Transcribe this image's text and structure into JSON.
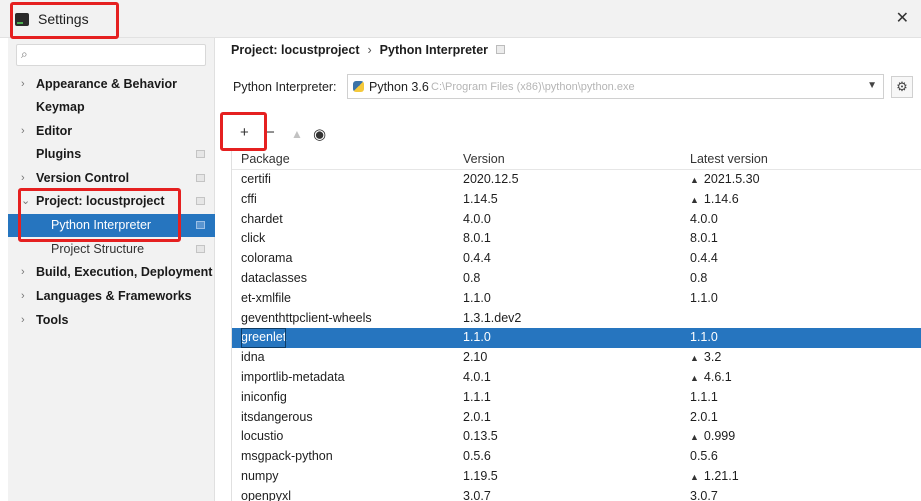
{
  "window": {
    "title": "Settings",
    "close_glyph": "✕"
  },
  "sidebar": {
    "search_placeholder": "",
    "items": [
      {
        "label": "Appearance & Behavior",
        "arrow": "›",
        "has_module_icon": false
      },
      {
        "label": "Keymap",
        "arrow": "",
        "has_module_icon": false
      },
      {
        "label": "Editor",
        "arrow": "›",
        "has_module_icon": false
      },
      {
        "label": "Plugins",
        "arrow": "",
        "has_module_icon": true
      },
      {
        "label": "Version Control",
        "arrow": "›",
        "has_module_icon": true
      },
      {
        "label": "Project: locustproject",
        "arrow": "⌄",
        "has_module_icon": true
      },
      {
        "label": "Python Interpreter",
        "arrow": "",
        "has_module_icon": true,
        "selected": true,
        "sub": true
      },
      {
        "label": "Project Structure",
        "arrow": "",
        "has_module_icon": true,
        "sub": true
      },
      {
        "label": "Build, Execution, Deployment",
        "arrow": "›",
        "has_module_icon": false
      },
      {
        "label": "Languages & Frameworks",
        "arrow": "›",
        "has_module_icon": false
      },
      {
        "label": "Tools",
        "arrow": "›",
        "has_module_icon": false
      }
    ]
  },
  "breadcrumb": {
    "project": "Project: locustproject",
    "separator": "›",
    "page": "Python Interpreter"
  },
  "interpreter": {
    "label": "Python Interpreter:",
    "value": "Python 3.6",
    "path": "C:\\Program Files (x86)\\python\\python.exe"
  },
  "toolbar": {
    "add": "+",
    "remove": "−",
    "upgrade": "▲",
    "show": "◉"
  },
  "table": {
    "columns": [
      "Package",
      "Version",
      "Latest version"
    ],
    "rows": [
      {
        "package": "certifi",
        "version": "2020.12.5",
        "latest": "2021.5.30",
        "upgrade": true
      },
      {
        "package": "cffi",
        "version": "1.14.5",
        "latest": "1.14.6",
        "upgrade": true
      },
      {
        "package": "chardet",
        "version": "4.0.0",
        "latest": "4.0.0",
        "upgrade": false
      },
      {
        "package": "click",
        "version": "8.0.1",
        "latest": "8.0.1",
        "upgrade": false
      },
      {
        "package": "colorama",
        "version": "0.4.4",
        "latest": "0.4.4",
        "upgrade": false
      },
      {
        "package": "dataclasses",
        "version": "0.8",
        "latest": "0.8",
        "upgrade": false
      },
      {
        "package": "et-xmlfile",
        "version": "1.1.0",
        "latest": "1.1.0",
        "upgrade": false
      },
      {
        "package": "geventhttpclient-wheels",
        "version": "1.3.1.dev2",
        "latest": "",
        "upgrade": false
      },
      {
        "package": "greenlet",
        "version": "1.1.0",
        "latest": "1.1.0",
        "upgrade": false,
        "selected": true
      },
      {
        "package": "idna",
        "version": "2.10",
        "latest": "3.2",
        "upgrade": true
      },
      {
        "package": "importlib-metadata",
        "version": "4.0.1",
        "latest": "4.6.1",
        "upgrade": true
      },
      {
        "package": "iniconfig",
        "version": "1.1.1",
        "latest": "1.1.1",
        "upgrade": false
      },
      {
        "package": "itsdangerous",
        "version": "2.0.1",
        "latest": "2.0.1",
        "upgrade": false
      },
      {
        "package": "locustio",
        "version": "0.13.5",
        "latest": "0.999",
        "upgrade": true
      },
      {
        "package": "msgpack-python",
        "version": "0.5.6",
        "latest": "0.5.6",
        "upgrade": false
      },
      {
        "package": "numpy",
        "version": "1.19.5",
        "latest": "1.21.1",
        "upgrade": true
      },
      {
        "package": "openpyxl",
        "version": "3.0.7",
        "latest": "3.0.7",
        "upgrade": false
      }
    ]
  },
  "colors": {
    "selection": "#2675bf",
    "highlight_box": "#e52020"
  }
}
